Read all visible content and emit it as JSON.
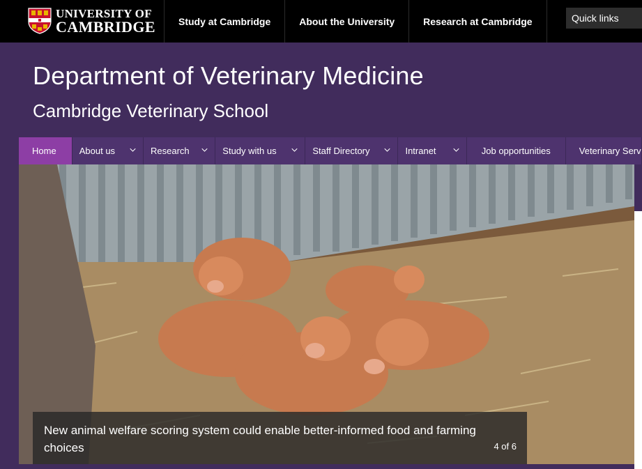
{
  "brand": {
    "line1": "UNIVERSITY OF",
    "line2": "CAMBRIDGE",
    "crest_colors": {
      "red": "#c8102e",
      "gold": "#e8b400",
      "white": "#ffffff"
    }
  },
  "topnav": {
    "items": [
      "Study at Cambridge",
      "About the University",
      "Research at Cambridge"
    ],
    "quick_links": "Quick links"
  },
  "header": {
    "title": "Department of Veterinary Medicine",
    "subtitle": "Cambridge Veterinary School"
  },
  "mainnav": {
    "items": [
      {
        "label": "Home",
        "active": true,
        "dropdown": false
      },
      {
        "label": "About us",
        "active": false,
        "dropdown": true
      },
      {
        "label": "Research",
        "active": false,
        "dropdown": true
      },
      {
        "label": "Study with us",
        "active": false,
        "dropdown": true
      },
      {
        "label": "Staff Directory",
        "active": false,
        "dropdown": true
      },
      {
        "label": "Intranet",
        "active": false,
        "dropdown": true
      },
      {
        "label": "Job opportunities",
        "active": false,
        "dropdown": false
      },
      {
        "label": "Veterinary Serv",
        "active": false,
        "dropdown": false
      }
    ]
  },
  "carousel": {
    "caption": "New animal welfare scoring system could enable better-informed food and farming choices",
    "counter": "4 of 6",
    "image_icon": "piglets-photo"
  },
  "colors": {
    "topbar": "#000000",
    "header_purple": "#412c5c",
    "nav_purple": "#4e336e",
    "active_tab": "#8d3ea5"
  }
}
